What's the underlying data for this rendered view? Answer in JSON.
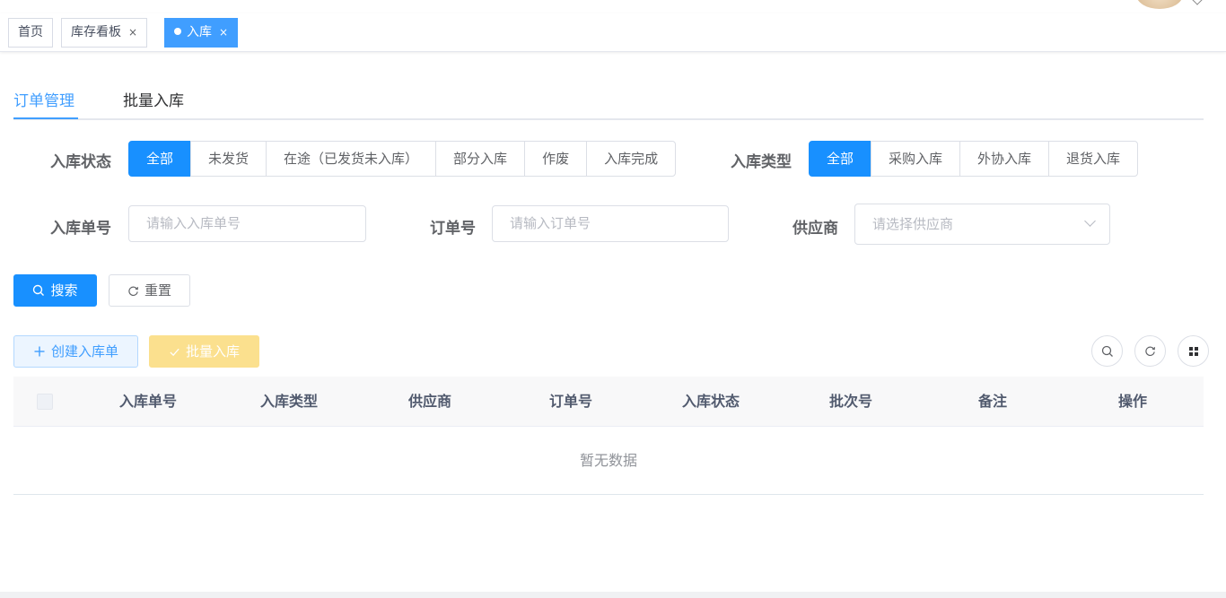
{
  "tags": [
    {
      "label": "首页",
      "closable": false,
      "active": false
    },
    {
      "label": "库存看板",
      "closable": true,
      "active": false
    },
    {
      "label": "入库",
      "closable": true,
      "active": true
    }
  ],
  "tag_close_glyph": "×",
  "tabs": [
    {
      "label": "订单管理",
      "active": true
    },
    {
      "label": "批量入库",
      "active": false
    }
  ],
  "filters": {
    "status": {
      "label": "入库状态",
      "options": [
        "全部",
        "未发货",
        "在途（已发货未入库）",
        "部分入库",
        "作废",
        "入库完成"
      ],
      "selected": "全部"
    },
    "type": {
      "label": "入库类型",
      "options": [
        "全部",
        "采购入库",
        "外协入库",
        "退货入库"
      ],
      "selected": "全部"
    },
    "inbound_no": {
      "label": "入库单号",
      "placeholder": "请输入入库单号",
      "value": ""
    },
    "order_no": {
      "label": "订单号",
      "placeholder": "请输入订单号",
      "value": ""
    },
    "supplier": {
      "label": "供应商",
      "placeholder": "请选择供应商",
      "value": ""
    }
  },
  "actions": {
    "search": "搜索",
    "reset": "重置",
    "create": "创建入库单",
    "batch": "批量入库"
  },
  "table": {
    "columns": [
      "入库单号",
      "入库类型",
      "供应商",
      "订单号",
      "入库状态",
      "批次号",
      "备注",
      "操作"
    ],
    "rows": [],
    "empty_text": "暂无数据"
  },
  "colors": {
    "primary": "#1890ff",
    "warning_disabled": "#fbe08e",
    "plain_bg": "#ecf5ff"
  },
  "icons": [
    "search-icon",
    "refresh-icon",
    "plus-icon",
    "check-icon",
    "grid-icon",
    "chevron-down-icon",
    "close-icon"
  ]
}
